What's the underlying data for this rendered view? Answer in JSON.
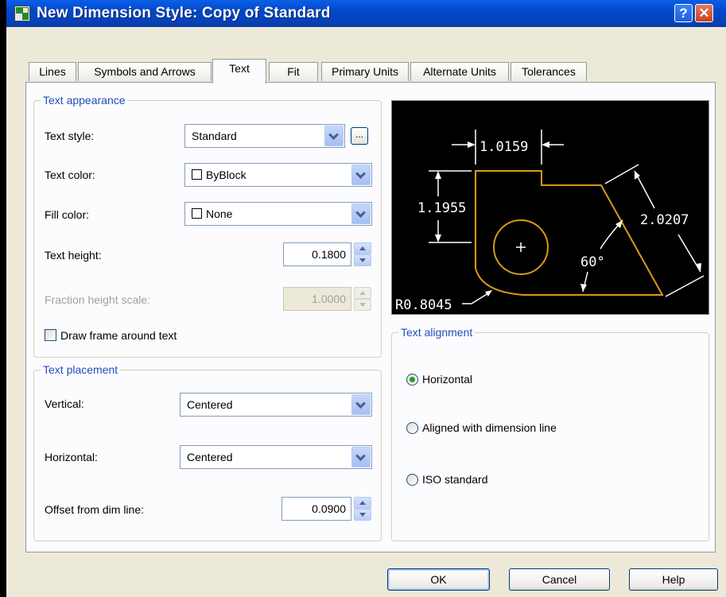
{
  "window": {
    "title": "New Dimension Style: Copy of Standard",
    "help_glyph": "?",
    "close_glyph": "✕"
  },
  "tabs": [
    {
      "label": "Lines"
    },
    {
      "label": "Symbols and Arrows"
    },
    {
      "label": "Text",
      "active": true
    },
    {
      "label": "Fit"
    },
    {
      "label": "Primary Units"
    },
    {
      "label": "Alternate Units"
    },
    {
      "label": "Tolerances"
    }
  ],
  "text_appearance": {
    "group_label": "Text appearance",
    "text_style_label": "Text style:",
    "text_style_value": "Standard",
    "ellipsis_label": "...",
    "text_color_label": "Text color:",
    "text_color_value": "ByBlock",
    "fill_color_label": "Fill color:",
    "fill_color_value": "None",
    "text_height_label": "Text height:",
    "text_height_value": "0.1800",
    "fraction_scale_label": "Fraction height scale:",
    "fraction_scale_value": "1.0000",
    "draw_frame_label": "Draw frame around text",
    "draw_frame_checked": false
  },
  "text_placement": {
    "group_label": "Text placement",
    "vertical_label": "Vertical:",
    "vertical_value": "Centered",
    "horizontal_label": "Horizontal:",
    "horizontal_value": "Centered",
    "offset_label": "Offset from dim line:",
    "offset_value": "0.0900"
  },
  "preview": {
    "dim_top": "1.0159",
    "dim_left": "1.1955",
    "dim_right": "2.0207",
    "angle": "60°",
    "radius": "R0.8045",
    "shape_color": "#d79a1a",
    "dim_color": "#ffffff"
  },
  "text_alignment": {
    "group_label": "Text alignment",
    "options": [
      {
        "label": "Horizontal",
        "selected": true
      },
      {
        "label": "Aligned with dimension line",
        "selected": false
      },
      {
        "label": "ISO standard",
        "selected": false
      }
    ]
  },
  "buttons": {
    "ok": "OK",
    "cancel": "Cancel",
    "help": "Help"
  }
}
